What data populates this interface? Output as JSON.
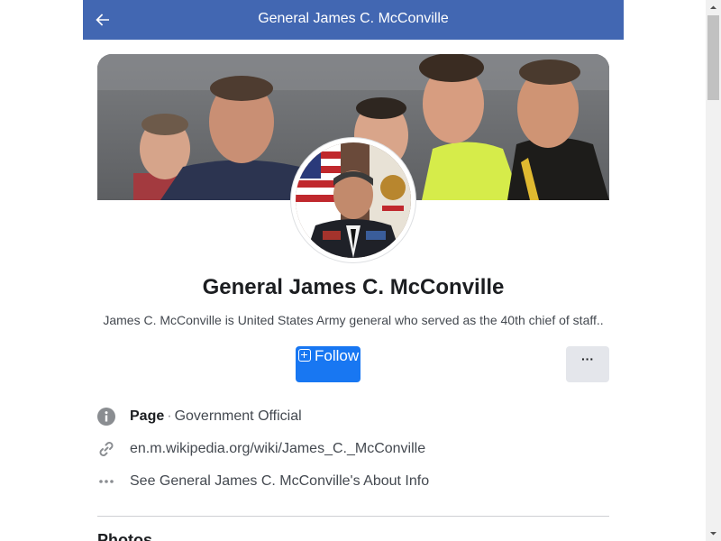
{
  "header": {
    "title": "General James C. McConville",
    "back_icon": "arrow-left-icon"
  },
  "profile": {
    "name": "General James C. McConville",
    "description": "James C. McConville is United States Army general who served as the 40th chief of staff..",
    "follow_label": "Follow",
    "follow_icon": "add-box-icon",
    "more_label": "···",
    "more_icon": "more-dots-icon"
  },
  "info": {
    "page_label": "Page",
    "page_separator": "·",
    "page_category": "Government Official",
    "link_text": "en.m.wikipedia.org/wiki/James_C._McConville",
    "about_text": "See General James C. McConville's About Info",
    "icons": [
      "info-circle-icon",
      "link-icon",
      "more-horizontal-icon"
    ]
  },
  "sections": {
    "photos_heading": "Photos"
  },
  "colors": {
    "header_bg": "#4267b2",
    "follow_bg": "#1877f2",
    "more_bg": "#e4e6eb",
    "text_primary": "#1c1e21",
    "text_secondary": "#444950"
  }
}
